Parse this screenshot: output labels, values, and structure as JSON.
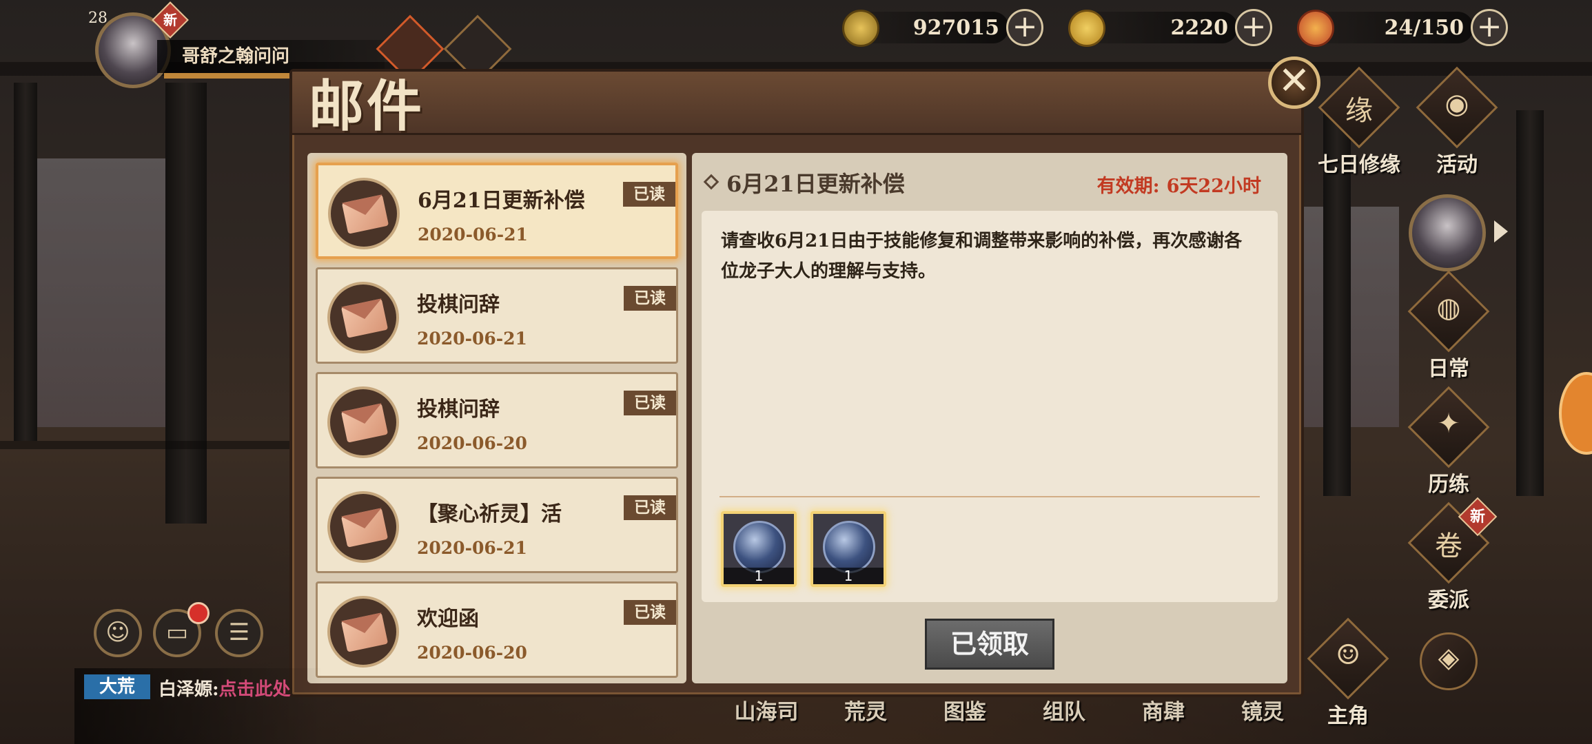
{
  "player": {
    "level": "28",
    "new_badge": "新",
    "name": "哥舒之翰问问"
  },
  "currency": [
    {
      "icon": "copper-coin-icon",
      "value": "927015"
    },
    {
      "icon": "jade-ring-icon",
      "value": "2220"
    },
    {
      "icon": "stamina-gourd-icon",
      "value": "24/150"
    }
  ],
  "mail": {
    "title": "邮件",
    "items": [
      {
        "title": "6月21日更新补偿",
        "date": "2020-06-21",
        "status": "已读",
        "icon": "gift-letter-icon"
      },
      {
        "title": "投棋问辞",
        "date": "2020-06-21",
        "status": "已读",
        "icon": "envelope-icon"
      },
      {
        "title": "投棋问辞",
        "date": "2020-06-20",
        "status": "已读",
        "icon": "envelope-icon"
      },
      {
        "title": "【聚心祈灵】活",
        "date": "2020-06-21",
        "status": "已读",
        "icon": "gift-letter-icon"
      },
      {
        "title": "欢迎函",
        "date": "2020-06-20",
        "status": "已读",
        "icon": "gift-letter-icon"
      }
    ],
    "detail": {
      "title": "6月21日更新补偿",
      "expiry_label": "有效期:",
      "expiry_value": "6天22小时",
      "message": "请查收6月21日由于技能修复和调整带来影响的补偿，再次感谢各位龙子大人的理解与支持。",
      "rewards": [
        {
          "icon": "blue-medal-icon",
          "qty": "1"
        },
        {
          "icon": "blue-medal-icon",
          "qty": "1"
        }
      ],
      "claimed_label": "已领取"
    }
  },
  "side_menu": [
    {
      "label": "七日修缘",
      "glyph": "缘"
    },
    {
      "label": "活动",
      "glyph": "◉"
    },
    {
      "label": "日常",
      "glyph": "◍"
    },
    {
      "label": "历练",
      "glyph": "✦"
    },
    {
      "label": "委派",
      "glyph": "卷",
      "new": "新"
    },
    {
      "label": "主角",
      "glyph": "☺"
    }
  ],
  "bottom_nav": [
    "山海司",
    "荒灵",
    "图鉴",
    "组队",
    "商肆",
    "镜灵"
  ],
  "chat": {
    "channel": "大荒",
    "speaker": "白泽嫄:",
    "link_text": "点击此处"
  },
  "colors": {
    "panel": "#4e3527",
    "accent_orange": "#e6a04e",
    "expiry_red": "#c23a22",
    "read_badge": "#6a4a30"
  }
}
